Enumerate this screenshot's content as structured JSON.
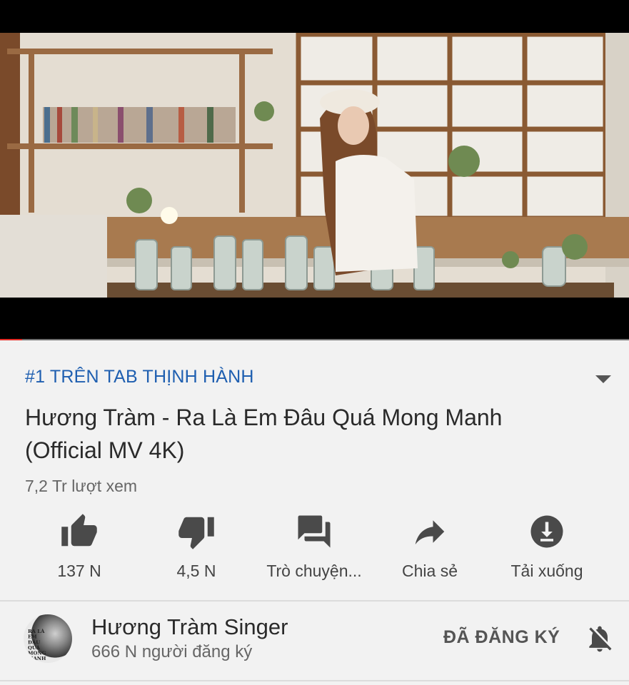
{
  "video": {
    "progress_fraction": 0.035
  },
  "trending": {
    "label": "#1 TRÊN TAB THỊNH HÀNH"
  },
  "video_info": {
    "title": "Hương Tràm - Ra Là Em Đâu Quá Mong Manh (Official MV 4K)",
    "views": "7,2 Tr lượt xem"
  },
  "actions": [
    {
      "icon": "thumbs-up-icon",
      "label": "137 N"
    },
    {
      "icon": "thumbs-down-icon",
      "label": "4,5 N"
    },
    {
      "icon": "chat-icon",
      "label": "Trò chuyện..."
    },
    {
      "icon": "share-icon",
      "label": "Chia sẻ"
    },
    {
      "icon": "download-icon",
      "label": "Tải xuống"
    }
  ],
  "channel": {
    "name": "Hương Tràm Singer",
    "subscribers": "666 N người đăng ký",
    "avatar_text": "RA LÀ EM ĐÂU QUÁ MONG MANH",
    "subscribe_label": "ĐÃ ĐĂNG KÝ"
  },
  "colors": {
    "accent_blue": "#1f5fb0",
    "progress_red": "#e52d27",
    "background": "#f2f2f2"
  }
}
